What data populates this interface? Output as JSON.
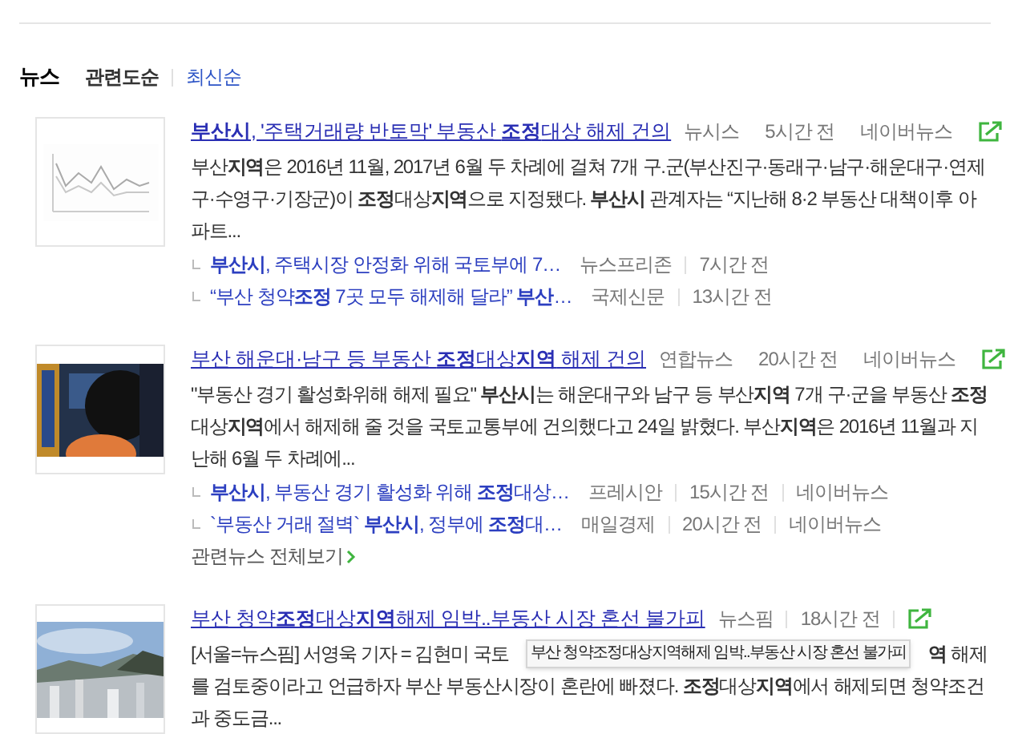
{
  "section_title": "뉴스",
  "sort_options": [
    {
      "label": "관련도순",
      "selected": true
    },
    {
      "label": "최신순",
      "selected": false
    }
  ],
  "articles": [
    {
      "title": "**부산시**, '주택거래량 반토막' 부동산 **조정**대상 해제 건의",
      "source": "뉴시스",
      "time": "5시간 전",
      "naver": "네이버뉴스",
      "body": "부산**지역**은 2016년 11월, 2017년 6월 두 차례에 걸쳐 7개 구.군(부산진구·동래구·남구·해운대구·연제구·수영구·기장군)이 **조정**대상**지역**으로 지정됐다. **부산시** 관계자는 “지난해 8·2 부동산 대책이후 아파트...",
      "related": [
        {
          "title": "**부산시**, 주택시장 안정화 위해 국토부에 7…",
          "source": "뉴스프리존",
          "time": "7시간 전"
        },
        {
          "title": "“부산 청약**조정** 7곳 모두 해제해 달라” **부산**…",
          "source": "국제신문",
          "time": "13시간 전"
        }
      ]
    },
    {
      "title": "부산 해운대·남구 등 부동산 **조정**대상**지역** 해제 건의",
      "source": "연합뉴스",
      "time": "20시간 전",
      "naver": "네이버뉴스",
      "body": "\"부동산 경기 활성화위해 해제 필요\" **부산시**는 해운대구와 남구 등 부산**지역** 7개 구·군을 부동산 **조정**대상**지역**에서 해제해 줄 것을 국토교통부에 건의했다고 24일 밝혔다. 부산**지역**은 2016년 11월과 지난해 6월 두 차례에...",
      "related": [
        {
          "title": "**부산시**, 부동산 경기 활성화 위해 **조정**대상…",
          "source": "프레시안",
          "time": "15시간 전",
          "naver": "네이버뉴스"
        },
        {
          "title": "`부동산 거래 절벽` **부산시**, 정부에 **조정**대…",
          "source": "매일경제",
          "time": "20시간 전",
          "naver": "네이버뉴스"
        }
      ],
      "more": "관련뉴스 전체보기"
    },
    {
      "title": "부산 청약**조정**대상**지역**해제 임박..부동산 시장 혼선 불가피",
      "source": "뉴스핌",
      "time": "18시간 전",
      "body_line1_start": "[서울=뉴스핌] 서영욱 기자 = 김현미 국토",
      "body_line1_end": "**역** 해제",
      "body": "를 검토중이라고 언급하자 부산 부동산시장이 혼란에 빠졌다. **조정**대상**지역**에서 해제되면 청약조건과 중도금...",
      "tooltip": "부산 청약조정대상지역해제 임박..부동산 시장 혼선 불가피"
    }
  ]
}
